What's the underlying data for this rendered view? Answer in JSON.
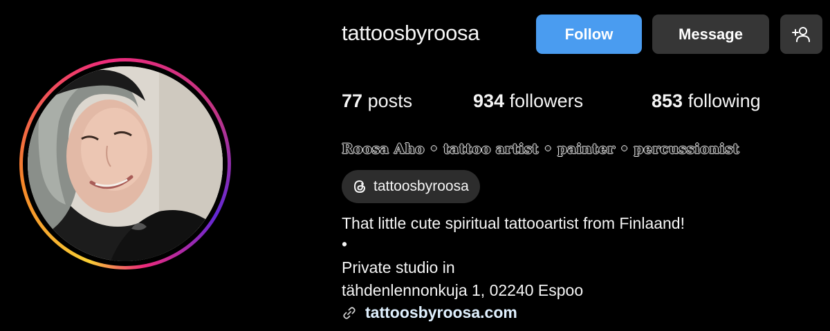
{
  "profile": {
    "username": "tattoosbyroosa",
    "avatar_icon": "profile-photo",
    "story_ring_colors": [
      "#f9ce34",
      "#ee2a7b",
      "#6228d7"
    ]
  },
  "actions": {
    "follow_label": "Follow",
    "message_label": "Message",
    "add_user_icon": "person-plus-icon",
    "follow_color": "#4a9cf0",
    "secondary_color": "#363636"
  },
  "stats": {
    "posts_count": "77",
    "posts_label": "posts",
    "followers_count": "934",
    "followers_label": "followers",
    "following_count": "853",
    "following_label": "following"
  },
  "bio": {
    "full_name": "Roosa Aho • tattoo artist  •  painter • percussionist",
    "threads_handle": "tattoosbyroosa",
    "threads_icon": "threads-icon",
    "line1": "That little cute spiritual tattooartist from Finlaand!",
    "line2": "•",
    "line3": "Private studio in",
    "line4": "tähdenlennonkuja 1, 02240 Espoo",
    "link_icon": "link-icon",
    "website": "tattoosbyroosa.com",
    "link_color": "#e0f1ff"
  }
}
